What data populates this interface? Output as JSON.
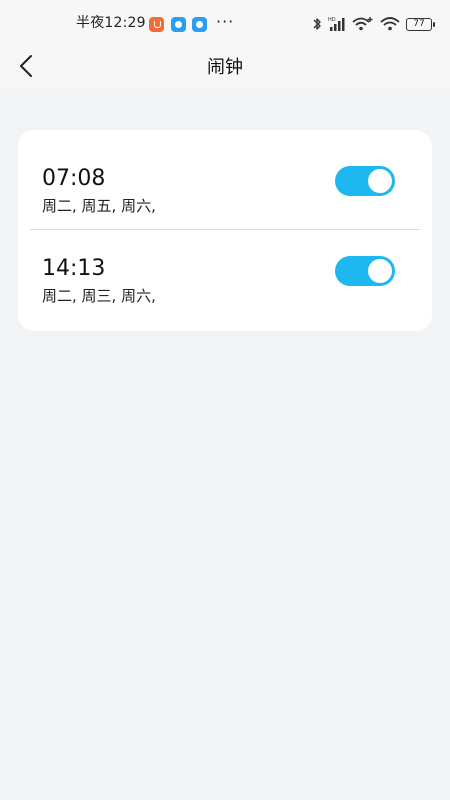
{
  "status_bar": {
    "time": "半夜12:29",
    "more": "···",
    "battery": "77"
  },
  "header": {
    "title": "闹钟"
  },
  "alarms": [
    {
      "time": "07:08",
      "days": "周二, 周五, 周六,",
      "enabled": true
    },
    {
      "time": "14:13",
      "days": "周二, 周三, 周六,",
      "enabled": true
    }
  ],
  "colors": {
    "accent": "#1cb8ef",
    "background": "#f2f3f5",
    "card": "#ffffff"
  }
}
